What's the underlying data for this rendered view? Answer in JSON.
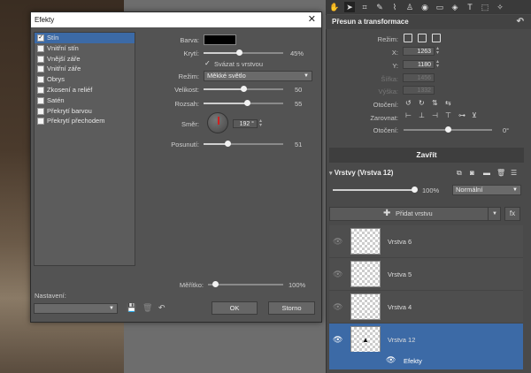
{
  "toolbar": {
    "tools": [
      "hand-icon",
      "pointer-icon",
      "crop-icon",
      "pen-icon",
      "brush-icon",
      "stamp-icon",
      "eye-icon",
      "eraser-icon",
      "bucket-icon",
      "text-icon",
      "selection-icon",
      "wand-icon"
    ]
  },
  "transform": {
    "title": "Přesun a transformace",
    "mode_label": "Režim:",
    "x_label": "X:",
    "x_value": "1263",
    "y_label": "Y:",
    "y_value": "1180",
    "width_label": "Šířka:",
    "width_value": "1456",
    "height_label": "Výška:",
    "height_value": "1332",
    "rotate_label": "Otočení:",
    "align_label": "Zarovnat:",
    "rotation_label": "Otočení:",
    "rotation_value": "0°",
    "rotation_fraction": 0.5,
    "close_label": "Zavřít"
  },
  "layers": {
    "title": "Vrstvy (Vrstva 12)",
    "opacity_value": "100%",
    "opacity_fraction": 1.0,
    "blend_mode": "Normální",
    "add_label": "Přidat vrstvu",
    "fx_label": "fx",
    "items": [
      {
        "name": "Vrstva 6",
        "selected": false
      },
      {
        "name": "Vrstva 5",
        "selected": false
      },
      {
        "name": "Vrstva 4",
        "selected": false
      },
      {
        "name": "Vrstva 12",
        "selected": true
      }
    ],
    "effects_label": "Efekty"
  },
  "dialog": {
    "title": "Efekty",
    "effects": [
      {
        "label": "Stín",
        "checked": true,
        "selected": true
      },
      {
        "label": "Vnitřní stín",
        "checked": false,
        "selected": false
      },
      {
        "label": "Vnější záře",
        "checked": false,
        "selected": false
      },
      {
        "label": "Vnitřní záře",
        "checked": false,
        "selected": false
      },
      {
        "label": "Obrys",
        "checked": false,
        "selected": false
      },
      {
        "label": "Zkosení a reliéf",
        "checked": false,
        "selected": false
      },
      {
        "label": "Satén",
        "checked": false,
        "selected": false
      },
      {
        "label": "Překrytí barvou",
        "checked": false,
        "selected": false
      },
      {
        "label": "Překrytí přechodem",
        "checked": false,
        "selected": false
      }
    ],
    "color_label": "Barva:",
    "color_value": "#000000",
    "opacity_label": "Krytí:",
    "opacity_value": "45%",
    "opacity_fraction": 0.45,
    "link_label": "Svázat s vrstvou",
    "link_checked": true,
    "mode_label": "Režim:",
    "mode_value": "Měkké světlo",
    "size_label": "Velikost:",
    "size_value": "50",
    "size_fraction": 0.5,
    "range_label": "Rozsah:",
    "range_value": "55",
    "range_fraction": 0.55,
    "angle_label": "Směr:",
    "angle_value": "192 °",
    "offset_label": "Posunutí:",
    "offset_value": "51",
    "offset_fraction": 0.3,
    "scale_label": "Měřítko:",
    "scale_value": "100%",
    "scale_fraction": 0.1,
    "preset_label": "Nastavení:",
    "preset_value": "",
    "ok_label": "OK",
    "cancel_label": "Storno"
  }
}
